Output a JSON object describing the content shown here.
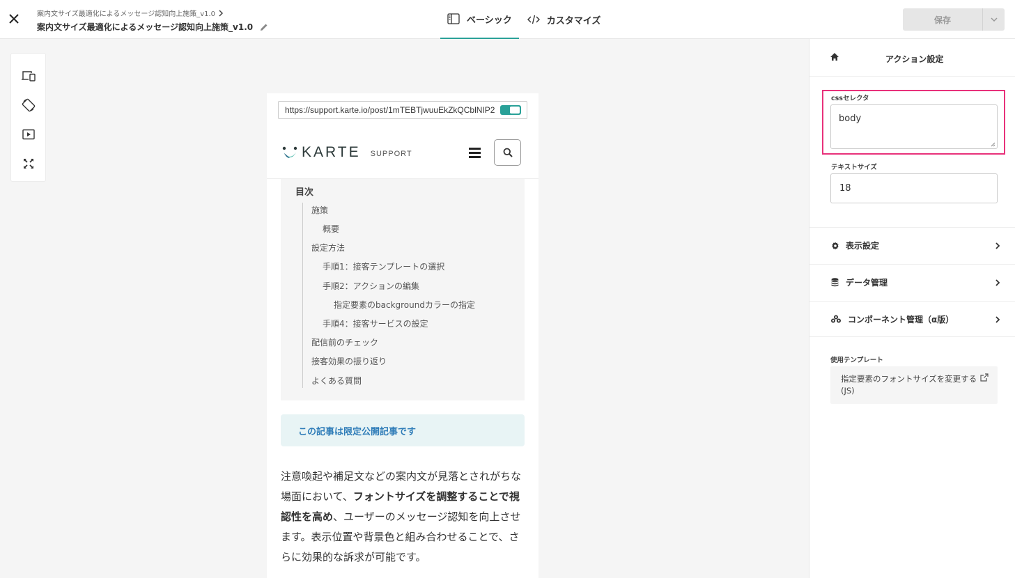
{
  "header": {
    "breadcrumb": "案内文サイズ最適化によるメッセージ認知向上施策_v1.0",
    "title": "案内文サイズ最適化によるメッセージ認知向上施策_v1.0",
    "tabs": [
      {
        "label": "ベーシック",
        "active": true
      },
      {
        "label": "カスタマイズ",
        "active": false
      }
    ],
    "save_label": "保存"
  },
  "toolbar": {
    "icons": [
      "device-switch-icon",
      "rotate-icon",
      "play-icon",
      "fullscreen-icon"
    ]
  },
  "preview": {
    "url": "https://support.karte.io/post/1mTEBTjwuuEkZkQCblNIP2",
    "logo_text": "KARTE",
    "logo_sub": "SUPPORT",
    "toc": {
      "title": "目次",
      "items": [
        {
          "label": "施策",
          "level": 1
        },
        {
          "label": "概要",
          "level": 2
        },
        {
          "label": "設定方法",
          "level": 1
        },
        {
          "label": "手順1：接客テンプレートの選択",
          "level": 2
        },
        {
          "label": "手順2：アクションの編集",
          "level": 2
        },
        {
          "label": "指定要素のbackgroundカラーの指定",
          "level": 3
        },
        {
          "label": "手順4：接客サービスの設定",
          "level": 2
        },
        {
          "label": "配信前のチェック",
          "level": 1
        },
        {
          "label": "接客効果の振り返り",
          "level": 1
        },
        {
          "label": "よくある質問",
          "level": 1
        }
      ]
    },
    "notice": "この記事は限定公開記事です",
    "body": {
      "part1": "注意喚起や補足文などの案内文が見落とされがちな場面において、",
      "bold": "フォントサイズを調整することで視認性を高め",
      "part2": "、ユーザーのメッセージ認知を向上させます。表示位置や背景色と組み合わせることで、さらに効果的な訴求が可能です。"
    }
  },
  "panel": {
    "title": "アクション設定",
    "css_label": "cssセレクタ",
    "css_value": "body",
    "text_size_label": "テキストサイズ",
    "text_size_value": "18",
    "sections": [
      {
        "label": "表示設定",
        "icon": "gear-icon"
      },
      {
        "label": "データ管理",
        "icon": "database-icon"
      },
      {
        "label": "コンポーネント管理（α版）",
        "icon": "components-icon"
      }
    ],
    "template_label": "使用テンプレート",
    "template_name": "指定要素のフォントサイズを変更する(JS)"
  },
  "colors": {
    "accent": "#2aa198",
    "highlight": "#e8317a",
    "notice_bg": "#e8f4f5",
    "notice_text": "#2e7cb8"
  }
}
